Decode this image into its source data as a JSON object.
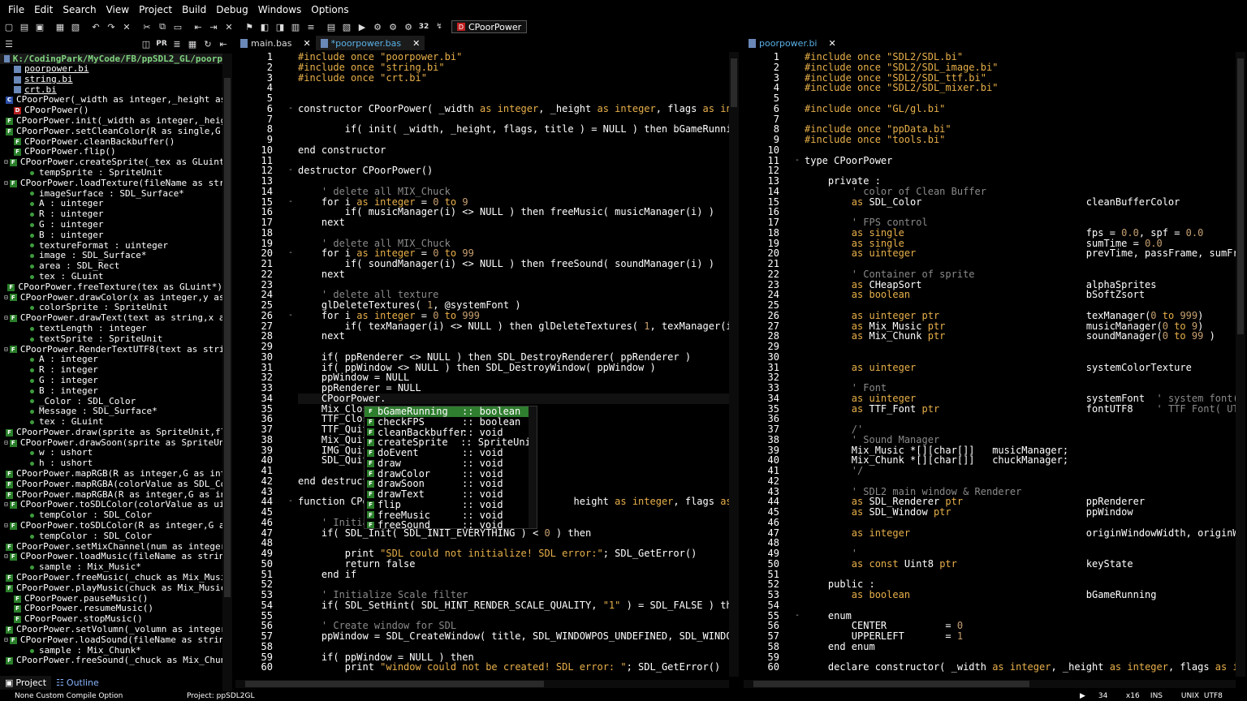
{
  "menu": [
    "File",
    "Edit",
    "Search",
    "View",
    "Project",
    "Build",
    "Debug",
    "Windows",
    "Options"
  ],
  "toolbar_tab": {
    "badge": "D",
    "label": "CPoorPower"
  },
  "left_toolbar": [
    "PR"
  ],
  "tree": {
    "root": "K:/CodingPark/MyCode/FB/ppSDL2_GL/poorp",
    "rows": [
      {
        "t": "file",
        "label": "poorpower.bi",
        "link": true,
        "lvl": 1
      },
      {
        "t": "file",
        "label": "string.bi",
        "link": true,
        "lvl": 1
      },
      {
        "t": "file",
        "label": "crt.bi",
        "link": true,
        "lvl": 1
      },
      {
        "t": "C",
        "label": "CPoorPower(_width as integer,_height as in",
        "lvl": 1
      },
      {
        "t": "D",
        "label": "CPoorPower()",
        "lvl": 1
      },
      {
        "t": "F",
        "label": "CPoorPower.init(_width as integer,_height",
        "lvl": 1
      },
      {
        "t": "F",
        "label": "CPoorPower.setCleanColor(R as single,G as",
        "lvl": 1
      },
      {
        "t": "F",
        "label": "CPoorPower.cleanBackbuffer()",
        "lvl": 1
      },
      {
        "t": "F",
        "label": "CPoorPower.flip()",
        "lvl": 1
      },
      {
        "t": "F",
        "label": "CPoorPower.createSprite(_tex as GLuint,x a",
        "lvl": 1,
        "toggle": true
      },
      {
        "t": "v",
        "label": "tempSprite : SpriteUnit",
        "lvl": 2
      },
      {
        "t": "F",
        "label": "CPoorPower.loadTexture(fileName as string,",
        "lvl": 1,
        "toggle": true
      },
      {
        "t": "v",
        "label": "imageSurface : SDL_Surface*",
        "lvl": 2
      },
      {
        "t": "v",
        "label": "A : uinteger",
        "lvl": 2
      },
      {
        "t": "v",
        "label": "R : uinteger",
        "lvl": 2
      },
      {
        "t": "v",
        "label": "G : uinteger",
        "lvl": 2
      },
      {
        "t": "v",
        "label": "B : uinteger",
        "lvl": 2
      },
      {
        "t": "v",
        "label": "textureFormat : uinteger",
        "lvl": 2
      },
      {
        "t": "v",
        "label": "image : SDL_Surface*",
        "lvl": 2
      },
      {
        "t": "v",
        "label": "area : SDL_Rect",
        "lvl": 2
      },
      {
        "t": "v",
        "label": "tex : GLuint",
        "lvl": 2
      },
      {
        "t": "F",
        "label": "CPoorPower.freeTexture(tex as GLuint*)",
        "lvl": 1
      },
      {
        "t": "F",
        "label": "CPoorPower.drawColor(x as integer,y as int",
        "lvl": 1,
        "toggle": true
      },
      {
        "t": "v",
        "label": "colorSprite : SpriteUnit",
        "lvl": 2
      },
      {
        "t": "F",
        "label": "CPoorPower.drawText(text as string,x as in",
        "lvl": 1,
        "toggle": true
      },
      {
        "t": "v",
        "label": "textLength : integer",
        "lvl": 2
      },
      {
        "t": "v",
        "label": "textSprite : SpriteUnit",
        "lvl": 2
      },
      {
        "t": "F",
        "label": "CPoorPower.RenderTextUTF8(text as string,x",
        "lvl": 1,
        "toggle": true
      },
      {
        "t": "v",
        "label": "A : integer",
        "lvl": 2
      },
      {
        "t": "v",
        "label": "R : integer",
        "lvl": 2
      },
      {
        "t": "v",
        "label": "G : integer",
        "lvl": 2
      },
      {
        "t": "v",
        "label": "B : integer",
        "lvl": 2
      },
      {
        "t": "v",
        "label": "_Color : SDL_Color",
        "lvl": 2
      },
      {
        "t": "v",
        "label": "Message : SDL_Surface*",
        "lvl": 2
      },
      {
        "t": "v",
        "label": "tex : GLuint",
        "lvl": 2
      },
      {
        "t": "F",
        "label": "CPoorPower.draw(sprite as SpriteUnit,flag",
        "lvl": 1
      },
      {
        "t": "F",
        "label": "CPoorPower.drawSoon(sprite as SpriteUnit,f",
        "lvl": 1,
        "toggle": true
      },
      {
        "t": "v",
        "label": "w : ushort",
        "lvl": 2
      },
      {
        "t": "v",
        "label": "h : ushort",
        "lvl": 2
      },
      {
        "t": "F",
        "label": "CPoorPower.mapRGB(R as integer,G as intege",
        "lvl": 1
      },
      {
        "t": "F",
        "label": "CPoorPower.mapRGBA(colorValue as SDL_Color",
        "lvl": 1
      },
      {
        "t": "F",
        "label": "CPoorPower.mapRGBA(R as integer,G as integ",
        "lvl": 1
      },
      {
        "t": "F",
        "label": "CPoorPower.toSDLColor(colorValue as uinteg",
        "lvl": 1,
        "toggle": true
      },
      {
        "t": "v",
        "label": "tempColor : SDL_Color",
        "lvl": 2
      },
      {
        "t": "F",
        "label": "CPoorPower.toSDLColor(R as integer,G as in",
        "lvl": 1,
        "toggle": true
      },
      {
        "t": "v",
        "label": "tempColor : SDL_Color",
        "lvl": 2
      },
      {
        "t": "F",
        "label": "CPoorPower.setMixChannel(num as integer) :",
        "lvl": 1
      },
      {
        "t": "F",
        "label": "CPoorPower.loadMusic(fileName as string) :",
        "lvl": 1,
        "toggle": true
      },
      {
        "t": "v",
        "label": "sample : Mix_Music*",
        "lvl": 2
      },
      {
        "t": "F",
        "label": "CPoorPower.freeMusic(_chuck as Mix_Music*)",
        "lvl": 1
      },
      {
        "t": "F",
        "label": "CPoorPower.playMusic(chuck as Mix_Music*,l",
        "lvl": 1
      },
      {
        "t": "F",
        "label": "CPoorPower.pauseMusic()",
        "lvl": 1
      },
      {
        "t": "F",
        "label": "CPoorPower.resumeMusic()",
        "lvl": 1
      },
      {
        "t": "F",
        "label": "CPoorPower.stopMusic()",
        "lvl": 1
      },
      {
        "t": "F",
        "label": "CPoorPower.setVolumn(_volumn as integer)",
        "lvl": 1
      },
      {
        "t": "F",
        "label": "CPoorPower.loadSound(fileName as string) :",
        "lvl": 1,
        "toggle": true
      },
      {
        "t": "v",
        "label": "sample : Mix_Chunk*",
        "lvl": 2
      },
      {
        "t": "F",
        "label": "CPoorPower.freeSound(_chuck as Mix_Chunk*)",
        "lvl": 1
      }
    ]
  },
  "panel_tabs": [
    "Project",
    "Outline"
  ],
  "left_editor": {
    "tabs": [
      {
        "label": "main.bas",
        "active": false
      },
      {
        "label": "*poorpower.bas",
        "active": true
      }
    ],
    "first_line": 1,
    "folds": {
      "6": "-",
      "12": "-",
      "15": "-",
      "20": "-",
      "26": "-",
      "44": "-"
    },
    "lines": [
      "#include once \"poorpower.bi\"",
      "#include once \"string.bi\"",
      "#include once \"crt.bi\"",
      "",
      "",
      "constructor CPoorPower( _width as integer, _height as integer, flags as integer, ti",
      "",
      "        if( init( _width, _height, flags, title ) = NULL ) then bGameRunning = fals",
      "",
      "end constructor",
      "",
      "destructor CPoorPower()",
      "",
      "    ' delete all MIX_Chuck",
      "    for i as integer = 0 to 9",
      "        if( musicManager(i) <> NULL ) then freeMusic( musicManager(i) )",
      "    next",
      "",
      "    ' delete all MIX_Chuck",
      "    for i as integer = 0 to 99",
      "        if( soundManager(i) <> NULL ) then freeSound( soundManager(i) )",
      "    next",
      "",
      "    ' delete all texture",
      "    glDeleteTextures( 1, @systemFont )",
      "    for i as integer = 0 to 999",
      "        if( texManager(i) <> NULL ) then glDeleteTextures( 1, texManager(i) )",
      "    next",
      "",
      "    if( ppRenderer <> NULL ) then SDL_DestroyRenderer( ppRenderer )",
      "    if( ppWindow <> NULL ) then SDL_DestroyWindow( ppWindow )",
      "    ppWindow = NULL",
      "    ppRenderer = NULL",
      "    CPoorPower.",
      "    Mix_Close",
      "    TTF_Close",
      "    TTF_Quit(",
      "    Mix_Quit(",
      "    IMG_Quit(",
      "    SDL_Quit(",
      "",
      "end destruct",
      "",
      "function CPoo                                  height as integer, flags as integer,",
      "",
      "    ' Initial",
      "    if( SDL_Init( SDL_INIT_EVERYTHING ) < 0 ) then",
      "",
      "        print \"SDL could not initialize! SDL error:\"; SDL_GetError()",
      "        return false",
      "    end if",
      "",
      "    ' Initialize Scale filter",
      "    if( SDL_SetHint( SDL_HINT_RENDER_SCALE_QUALITY, \"1\" ) = SDL_FALSE ) then print",
      "",
      "    ' Create window for SDL",
      "    ppWindow = SDL_CreateWindow( title, SDL_WINDOWPOS_UNDEFINED, SDL_WINDOWPOS_UNDE",
      "",
      "    if( ppWindow = NULL ) then",
      "        print \"window could not be created! SDL error: \"; SDL_GetError()"
    ]
  },
  "right_editor": {
    "tabs": [
      {
        "label": "poorpower.bi",
        "active": true
      }
    ],
    "first_line": 1,
    "folds": {
      "11": "-",
      "55": "-"
    },
    "lines": [
      "#include once \"SDL2/SDL.bi\"",
      "#include once \"SDL2/SDL_image.bi\"",
      "#include once \"SDL2/SDL_ttf.bi\"",
      "#include once \"SDL2/SDL_mixer.bi\"",
      "",
      "#include once \"GL/gl.bi\"",
      "",
      "#include once \"ppData.bi\"",
      "#include once \"tools.bi\"",
      "",
      "type CPoorPower",
      "",
      "    private :",
      "        ' color of Clean Buffer",
      "        as SDL_Color                            cleanBufferColor",
      "",
      "        ' FPS control",
      "        as single                               fps = 0.0, spf = 0.0",
      "        as single                               sumTime = 0.0",
      "        as uinteger                             prevTime, passFrame, sumFrame",
      "",
      "        ' Container of sprite",
      "        as CHeapSort                            alphaSprites",
      "        as boolean                              bSoftZsort",
      "",
      "        as uinteger ptr                         texManager(0 to 999)",
      "        as Mix_Music ptr                        musicManager(0 to 9)",
      "        as Mix_Chunk ptr                        soundManager(0 to 99 )",
      "",
      "",
      "        as uinteger                             systemColorTexture",
      "",
      "        ' Font",
      "        as uinteger                             systemFont  ' system font( Font.tga )",
      "        as TTF_Font ptr                         fontUTF8    ' TTF Font( UTF-8, support",
      "",
      "        /'",
      "        ' Sound Manager",
      "        Mix_Music *[][char[]]   musicManager;",
      "        Mix_Chunk *[][char[]]   chuckManager;",
      "        '/",
      "",
      "        ' SDL2 main window & Renderer",
      "        as SDL_Renderer ptr                     ppRenderer",
      "        as SDL_Window ptr                       ppWindow",
      "",
      "        as integer                              originWindowWidth, originWindowHeight",
      "",
      "        '",
      "        as const Uint8 ptr                      keyState",
      "",
      "    public :",
      "        as boolean                              bGameRunning",
      "",
      "    enum",
      "        CENTER          = 0",
      "        UPPERLEFT       = 1",
      "    end enum",
      "",
      "    declare constructor( _width as integer, _height as integer, flags as integer ="
    ]
  },
  "autocomplete": {
    "items": [
      {
        "name": "bGameRunning",
        "type": ":: boolean",
        "selected": true
      },
      {
        "name": "checkFPS",
        "type": ":: boolean"
      },
      {
        "name": "cleanBackbuffer",
        "type": ":: void"
      },
      {
        "name": "createSprite",
        "type": ":: SpriteUnit"
      },
      {
        "name": "doEvent",
        "type": ":: void"
      },
      {
        "name": "draw",
        "type": ":: void"
      },
      {
        "name": "drawColor",
        "type": ":: void"
      },
      {
        "name": "drawSoon",
        "type": ":: void"
      },
      {
        "name": "drawText",
        "type": ":: void"
      },
      {
        "name": "flip",
        "type": ":: void"
      },
      {
        "name": "freeMusic",
        "type": ":: void"
      },
      {
        "name": "freeSound",
        "type": ":: void"
      }
    ]
  },
  "status": {
    "left": "None Custom Compile Option",
    "project": "Project: ppSDL2GL",
    "line": "34",
    "col": "x16",
    "mode": "INS",
    "eol": "UNIX",
    "enc": "UTF8"
  }
}
